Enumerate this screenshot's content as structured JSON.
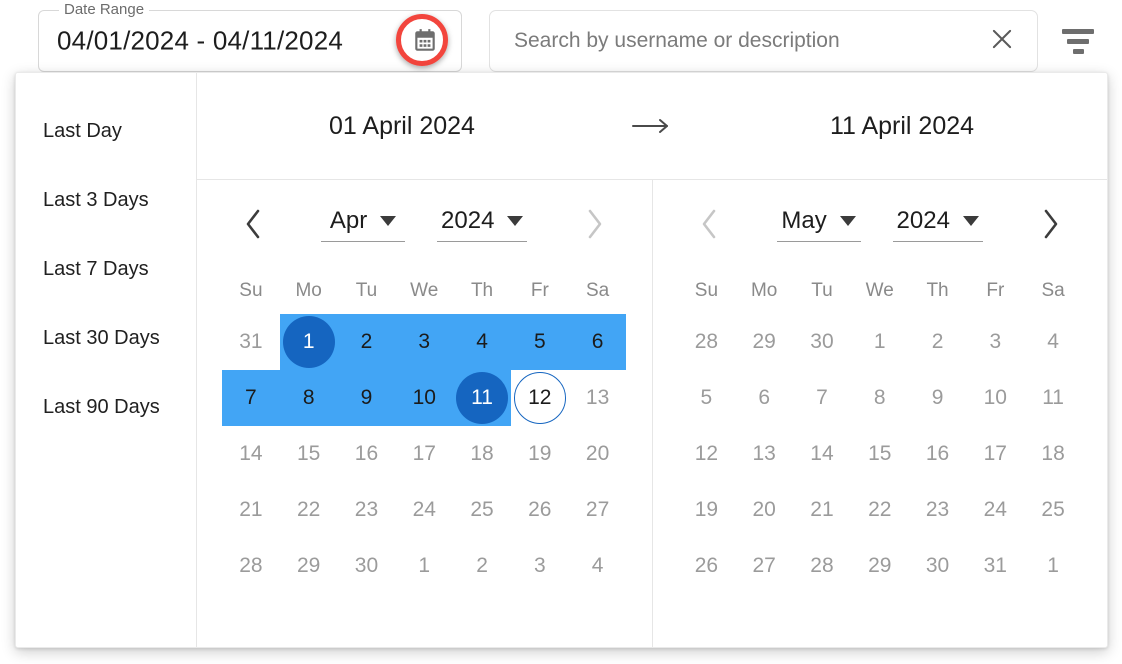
{
  "toolbar": {
    "date_field": {
      "label": "Date Range",
      "value": "04/01/2024 - 04/11/2024",
      "calendar_icon": "calendar-icon"
    },
    "search": {
      "placeholder": "Search by username or description",
      "value": "",
      "clear_icon": "close-icon"
    },
    "filter_icon": "filter-icon",
    "annotation_color": "#f2453d"
  },
  "picker": {
    "presets": [
      {
        "label": "Last Day"
      },
      {
        "label": "Last 3 Days"
      },
      {
        "label": "Last 7 Days"
      },
      {
        "label": "Last 30 Days"
      },
      {
        "label": "Last 90 Days"
      }
    ],
    "range_header": {
      "start": "01 April 2024",
      "arrow": "arrow-right-icon",
      "end": "11 April 2024"
    },
    "colors": {
      "range_band": "#42a5f5",
      "endpoint": "#1565c0",
      "today_ring": "#1565c0"
    },
    "weekdays": [
      "Su",
      "Mo",
      "Tu",
      "We",
      "Th",
      "Fr",
      "Sa"
    ],
    "months": [
      {
        "id": "left",
        "month": "Apr",
        "year": "2024",
        "prev_enabled": true,
        "next_enabled": false,
        "weeks": [
          [
            {
              "d": "31",
              "state": "outside"
            },
            {
              "d": "1",
              "state": "start"
            },
            {
              "d": "2",
              "state": "in"
            },
            {
              "d": "3",
              "state": "in"
            },
            {
              "d": "4",
              "state": "in"
            },
            {
              "d": "5",
              "state": "in"
            },
            {
              "d": "6",
              "state": "in"
            }
          ],
          [
            {
              "d": "7",
              "state": "in"
            },
            {
              "d": "8",
              "state": "in"
            },
            {
              "d": "9",
              "state": "in"
            },
            {
              "d": "10",
              "state": "in"
            },
            {
              "d": "11",
              "state": "end"
            },
            {
              "d": "12",
              "state": "today"
            },
            {
              "d": "13",
              "state": "normal"
            }
          ],
          [
            {
              "d": "14",
              "state": "normal"
            },
            {
              "d": "15",
              "state": "normal"
            },
            {
              "d": "16",
              "state": "normal"
            },
            {
              "d": "17",
              "state": "normal"
            },
            {
              "d": "18",
              "state": "normal"
            },
            {
              "d": "19",
              "state": "normal"
            },
            {
              "d": "20",
              "state": "normal"
            }
          ],
          [
            {
              "d": "21",
              "state": "normal"
            },
            {
              "d": "22",
              "state": "normal"
            },
            {
              "d": "23",
              "state": "normal"
            },
            {
              "d": "24",
              "state": "normal"
            },
            {
              "d": "25",
              "state": "normal"
            },
            {
              "d": "26",
              "state": "normal"
            },
            {
              "d": "27",
              "state": "normal"
            }
          ],
          [
            {
              "d": "28",
              "state": "normal"
            },
            {
              "d": "29",
              "state": "normal"
            },
            {
              "d": "30",
              "state": "normal"
            },
            {
              "d": "1",
              "state": "outside"
            },
            {
              "d": "2",
              "state": "outside"
            },
            {
              "d": "3",
              "state": "outside"
            },
            {
              "d": "4",
              "state": "outside"
            }
          ]
        ],
        "bands": [
          {
            "week": 0,
            "from": 1,
            "to": 7
          },
          {
            "week": 1,
            "from": 0,
            "to": 5
          }
        ]
      },
      {
        "id": "right",
        "month": "May",
        "year": "2024",
        "prev_enabled": false,
        "next_enabled": true,
        "weeks": [
          [
            {
              "d": "28",
              "state": "outside"
            },
            {
              "d": "29",
              "state": "outside"
            },
            {
              "d": "30",
              "state": "outside"
            },
            {
              "d": "1",
              "state": "normal"
            },
            {
              "d": "2",
              "state": "normal"
            },
            {
              "d": "3",
              "state": "normal"
            },
            {
              "d": "4",
              "state": "normal"
            }
          ],
          [
            {
              "d": "5",
              "state": "normal"
            },
            {
              "d": "6",
              "state": "normal"
            },
            {
              "d": "7",
              "state": "normal"
            },
            {
              "d": "8",
              "state": "normal"
            },
            {
              "d": "9",
              "state": "normal"
            },
            {
              "d": "10",
              "state": "normal"
            },
            {
              "d": "11",
              "state": "normal"
            }
          ],
          [
            {
              "d": "12",
              "state": "normal"
            },
            {
              "d": "13",
              "state": "normal"
            },
            {
              "d": "14",
              "state": "normal"
            },
            {
              "d": "15",
              "state": "normal"
            },
            {
              "d": "16",
              "state": "normal"
            },
            {
              "d": "17",
              "state": "normal"
            },
            {
              "d": "18",
              "state": "normal"
            }
          ],
          [
            {
              "d": "19",
              "state": "normal"
            },
            {
              "d": "20",
              "state": "normal"
            },
            {
              "d": "21",
              "state": "normal"
            },
            {
              "d": "22",
              "state": "normal"
            },
            {
              "d": "23",
              "state": "normal"
            },
            {
              "d": "24",
              "state": "normal"
            },
            {
              "d": "25",
              "state": "normal"
            }
          ],
          [
            {
              "d": "26",
              "state": "normal"
            },
            {
              "d": "27",
              "state": "normal"
            },
            {
              "d": "28",
              "state": "normal"
            },
            {
              "d": "29",
              "state": "normal"
            },
            {
              "d": "30",
              "state": "normal"
            },
            {
              "d": "31",
              "state": "normal"
            },
            {
              "d": "1",
              "state": "outside"
            }
          ]
        ],
        "bands": []
      }
    ]
  }
}
